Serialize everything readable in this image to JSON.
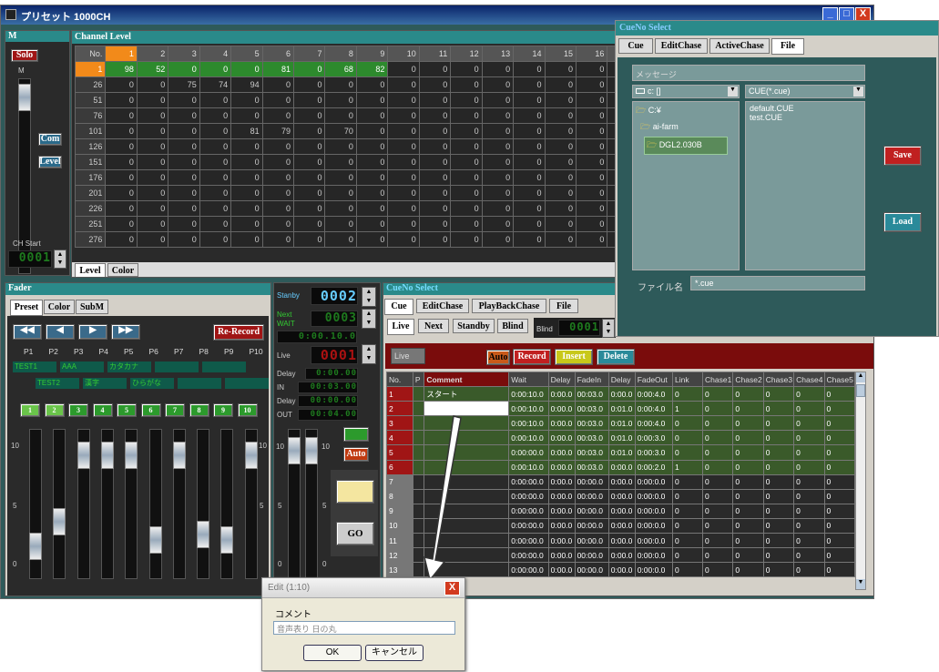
{
  "main_window": {
    "title": "プリセット 1000CH",
    "min": "_",
    "max": "□",
    "close": "X"
  },
  "m_panel": {
    "title": "M",
    "solo": "Solo",
    "label_m": "M",
    "com": "Com",
    "level": "Level",
    "ch_start": "CH Start",
    "ch_start_value": "0001"
  },
  "channel_level": {
    "title": "Channel Level",
    "header": [
      "No.",
      "1",
      "2",
      "3",
      "4",
      "5",
      "6",
      "7",
      "8",
      "9",
      "10",
      "11",
      "12",
      "13",
      "14",
      "15",
      "16",
      "17"
    ],
    "rows": [
      {
        "no": "1",
        "vals": [
          "98",
          "52",
          "0",
          "0",
          "0",
          "81",
          "0",
          "68",
          "82",
          "0",
          "0",
          "0",
          "0",
          "0",
          "0",
          "0",
          "0"
        ]
      },
      {
        "no": "26",
        "vals": [
          "0",
          "0",
          "75",
          "74",
          "94",
          "0",
          "0",
          "0",
          "0",
          "0",
          "0",
          "0",
          "0",
          "0",
          "0",
          "0",
          "0"
        ]
      },
      {
        "no": "51",
        "vals": [
          "0",
          "0",
          "0",
          "0",
          "0",
          "0",
          "0",
          "0",
          "0",
          "0",
          "0",
          "0",
          "0",
          "0",
          "0",
          "0",
          "0"
        ]
      },
      {
        "no": "76",
        "vals": [
          "0",
          "0",
          "0",
          "0",
          "0",
          "0",
          "0",
          "0",
          "0",
          "0",
          "0",
          "0",
          "0",
          "0",
          "0",
          "0",
          "0"
        ]
      },
      {
        "no": "101",
        "vals": [
          "0",
          "0",
          "0",
          "0",
          "81",
          "79",
          "0",
          "70",
          "0",
          "0",
          "0",
          "0",
          "0",
          "0",
          "0",
          "0",
          "0"
        ]
      },
      {
        "no": "126",
        "vals": [
          "0",
          "0",
          "0",
          "0",
          "0",
          "0",
          "0",
          "0",
          "0",
          "0",
          "0",
          "0",
          "0",
          "0",
          "0",
          "0",
          "0"
        ]
      },
      {
        "no": "151",
        "vals": [
          "0",
          "0",
          "0",
          "0",
          "0",
          "0",
          "0",
          "0",
          "0",
          "0",
          "0",
          "0",
          "0",
          "0",
          "0",
          "0",
          "0"
        ]
      },
      {
        "no": "176",
        "vals": [
          "0",
          "0",
          "0",
          "0",
          "0",
          "0",
          "0",
          "0",
          "0",
          "0",
          "0",
          "0",
          "0",
          "0",
          "0",
          "0",
          "0"
        ]
      },
      {
        "no": "201",
        "vals": [
          "0",
          "0",
          "0",
          "0",
          "0",
          "0",
          "0",
          "0",
          "0",
          "0",
          "0",
          "0",
          "0",
          "0",
          "0",
          "0",
          "0"
        ]
      },
      {
        "no": "226",
        "vals": [
          "0",
          "0",
          "0",
          "0",
          "0",
          "0",
          "0",
          "0",
          "0",
          "0",
          "0",
          "0",
          "0",
          "0",
          "0",
          "0",
          "0"
        ]
      },
      {
        "no": "251",
        "vals": [
          "0",
          "0",
          "0",
          "0",
          "0",
          "0",
          "0",
          "0",
          "0",
          "0",
          "0",
          "0",
          "0",
          "0",
          "0",
          "0",
          "0"
        ]
      },
      {
        "no": "276",
        "vals": [
          "0",
          "0",
          "0",
          "0",
          "0",
          "0",
          "0",
          "0",
          "0",
          "0",
          "0",
          "0",
          "0",
          "0",
          "0",
          "0",
          "0"
        ]
      }
    ],
    "tabs": [
      "Level",
      "Color"
    ]
  },
  "fader": {
    "title": "Fader",
    "tabs": [
      "Preset",
      "Color",
      "SubM"
    ],
    "rerecord": "Re-Record",
    "presets": [
      "P1",
      "P2",
      "P3",
      "P4",
      "P5",
      "P6",
      "P7",
      "P8",
      "P9",
      "P10"
    ],
    "names_row1": [
      "TEST1",
      "AAA",
      "カタカナ",
      "",
      ""
    ],
    "names_row2": [
      "TEST2",
      "漢字",
      "ひらがな",
      "",
      ""
    ],
    "nums": [
      "1",
      "2",
      "3",
      "4",
      "5",
      "6",
      "7",
      "8",
      "9",
      "10"
    ],
    "scale_top": "10",
    "scale_mid": "5",
    "scale_bot": "0",
    "levels": [
      0.15,
      0.35,
      0.9,
      0.9,
      0.9,
      0.2,
      0.9,
      0.25,
      0.2,
      0.9
    ]
  },
  "timing": {
    "standby": "Stanby",
    "standby_val": "0002",
    "next_wait": "Next WAIT",
    "next_val": "0003",
    "wait_val": "0:00.10.0",
    "live": "Live",
    "live_val": "0001",
    "delay": "Delay",
    "delay_val": "0:00.00",
    "in": "IN",
    "in_val": "00:03.00",
    "delay2": "Delay",
    "delay2_val": "00:00.00",
    "out": "OUT",
    "out_val": "00:04.00",
    "auto": "Auto",
    "go": "GO",
    "scale_top": "10",
    "scale_mid": "5",
    "scale_bot": "0"
  },
  "cueno": {
    "title": "CueNo Select",
    "tabs": [
      "Cue",
      "EditChase",
      "PlayBackChase",
      "File"
    ],
    "sub": [
      "Live",
      "Next",
      "Standby",
      "Blind"
    ],
    "blind": "Blind",
    "blind_val": "0001",
    "live_label": "Live",
    "auto": "Auto",
    "record": "Record",
    "insert": "Insert",
    "delete": "Delete",
    "header": [
      "No.",
      "P",
      "Comment",
      "Wait",
      "Delay",
      "FadeIn",
      "Delay",
      "FadeOut",
      "Link",
      "Chase1",
      "Chase2",
      "Chase3",
      "Chase4",
      "Chase5"
    ],
    "rows": [
      [
        "1",
        "",
        "スタート",
        "0:00:10.0",
        "0:00.0",
        "00:03.0",
        "0:00.0",
        "0:00:4.0",
        "0",
        "0",
        "0",
        "0",
        "0",
        "0"
      ],
      [
        "2",
        "",
        "",
        "0:00:10.0",
        "0:00.0",
        "00:03.0",
        "0:01.0",
        "0:00:4.0",
        "1",
        "0",
        "0",
        "0",
        "0",
        "0"
      ],
      [
        "3",
        "",
        "",
        "0:00:10.0",
        "0:00.0",
        "00:03.0",
        "0:01.0",
        "0:00:4.0",
        "0",
        "0",
        "0",
        "0",
        "0",
        "0"
      ],
      [
        "4",
        "",
        "",
        "0:00:10.0",
        "0:00.0",
        "00:03.0",
        "0:01.0",
        "0:00:3.0",
        "0",
        "0",
        "0",
        "0",
        "0",
        "0"
      ],
      [
        "5",
        "",
        "",
        "0:00:00.0",
        "0:00.0",
        "00:03.0",
        "0:01.0",
        "0:00:3.0",
        "0",
        "0",
        "0",
        "0",
        "0",
        "0"
      ],
      [
        "6",
        "",
        "",
        "0:00:10.0",
        "0:00.0",
        "00:03.0",
        "0:00.0",
        "0:00:2.0",
        "1",
        "0",
        "0",
        "0",
        "0",
        "0"
      ],
      [
        "7",
        "",
        "",
        "0:00:00.0",
        "0:00.0",
        "00:00.0",
        "0:00.0",
        "0:00:0.0",
        "0",
        "0",
        "0",
        "0",
        "0",
        "0"
      ],
      [
        "8",
        "",
        "",
        "0:00:00.0",
        "0:00.0",
        "00:00.0",
        "0:00.0",
        "0:00:0.0",
        "0",
        "0",
        "0",
        "0",
        "0",
        "0"
      ],
      [
        "9",
        "",
        "",
        "0:00:00.0",
        "0:00.0",
        "00:00.0",
        "0:00.0",
        "0:00:0.0",
        "0",
        "0",
        "0",
        "0",
        "0",
        "0"
      ],
      [
        "10",
        "",
        "",
        "0:00:00.0",
        "0:00.0",
        "00:00.0",
        "0:00.0",
        "0:00:0.0",
        "0",
        "0",
        "0",
        "0",
        "0",
        "0"
      ],
      [
        "11",
        "",
        "",
        "0:00:00.0",
        "0:00.0",
        "00:00.0",
        "0:00.0",
        "0:00:0.0",
        "0",
        "0",
        "0",
        "0",
        "0",
        "0"
      ],
      [
        "12",
        "",
        "",
        "0:00:00.0",
        "0:00.0",
        "00:00.0",
        "0:00.0",
        "0:00:0.0",
        "0",
        "0",
        "0",
        "0",
        "0",
        "0"
      ],
      [
        "13",
        "",
        "",
        "0:00:00.0",
        "0:00.0",
        "00:00.0",
        "0:00.0",
        "0:00:0.0",
        "0",
        "0",
        "0",
        "0",
        "0",
        "0"
      ]
    ]
  },
  "file_window": {
    "title": "CueNo Select",
    "tabs": [
      "Cue",
      "EditChase",
      "ActiveChase",
      "File"
    ],
    "message": "メッセージ",
    "drive": "c: []",
    "filter": "CUE(*.cue)",
    "folders": [
      "C:¥",
      "ai-farm",
      "DGL2.030B"
    ],
    "files": [
      "default.CUE",
      "test.CUE"
    ],
    "save": "Save",
    "load": "Load",
    "filename_label": "ファイル名",
    "filename": "*.cue"
  },
  "edit_dialog": {
    "title": "Edit (1:10)",
    "close": "X",
    "label": "コメント",
    "value": "音声表り 日の丸",
    "ok": "OK",
    "cancel": "キャンセル"
  }
}
